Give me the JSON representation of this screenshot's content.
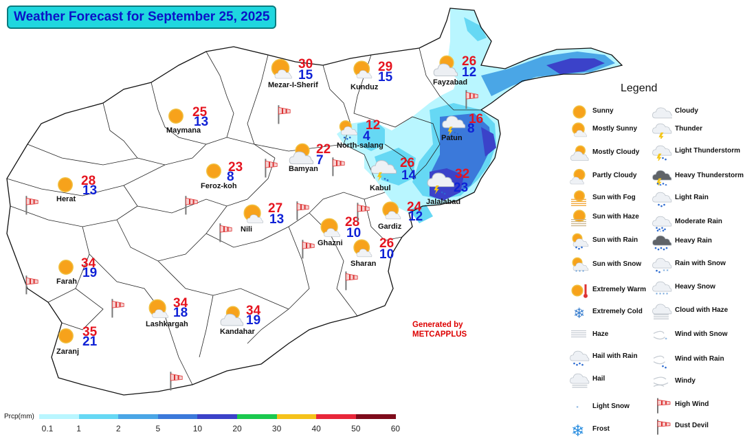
{
  "title": "Weather Forecast for September 25, 2025",
  "credit": {
    "line1": "Generated by",
    "line2": "METCAPPLUS"
  },
  "legend": {
    "title": "Legend",
    "left_column": [
      {
        "label": "Sunny",
        "icon": "sunny-icon"
      },
      {
        "label": "Mostly Sunny",
        "icon": "mostly-sunny-icon"
      },
      {
        "label": "Mostly Cloudy",
        "icon": "mostly-cloudy-icon"
      },
      {
        "label": "Partly Cloudy",
        "icon": "partly-cloudy-icon"
      },
      {
        "label": "Sun with Fog",
        "icon": "sun-fog-icon"
      },
      {
        "label": "Sun with Haze",
        "icon": "sun-haze-icon"
      },
      {
        "label": "Sun with Rain",
        "icon": "sun-rain-icon"
      },
      {
        "label": "Sun with Snow",
        "icon": "sun-snow-icon"
      },
      {
        "label": "Extremely Warm",
        "icon": "extremely-warm-icon"
      },
      {
        "label": "Extremely Cold",
        "icon": "extremely-cold-icon"
      },
      {
        "label": "Haze",
        "icon": "haze-icon"
      },
      {
        "label": "Hail with Rain",
        "icon": "hail-rain-icon"
      },
      {
        "label": "Hail",
        "icon": "hail-icon"
      },
      {
        "label": "Light Snow",
        "icon": "light-snow-icon"
      },
      {
        "label": "Frost",
        "icon": "frost-icon"
      }
    ],
    "right_column": [
      {
        "label": "Cloudy",
        "icon": "cloudy-icon"
      },
      {
        "label": "Thunder",
        "icon": "thunder-icon"
      },
      {
        "label": "Light Thunderstorm",
        "icon": "light-thunderstorm-icon"
      },
      {
        "label": "Heavy Thunderstorm",
        "icon": "heavy-thunderstorm-icon"
      },
      {
        "label": "Light Rain",
        "icon": "light-rain-icon"
      },
      {
        "label": "Moderate Rain",
        "icon": "moderate-rain-icon"
      },
      {
        "label": "Heavy Rain",
        "icon": "heavy-rain-icon"
      },
      {
        "label": "Rain with Snow",
        "icon": "rain-snow-icon"
      },
      {
        "label": "Heavy Snow",
        "icon": "heavy-snow-icon"
      },
      {
        "label": "Cloud with Haze",
        "icon": "cloud-haze-icon"
      },
      {
        "label": "Wind with Snow",
        "icon": "wind-snow-icon"
      },
      {
        "label": "Wind with Rain",
        "icon": "wind-rain-icon"
      },
      {
        "label": "Windy",
        "icon": "windy-icon"
      },
      {
        "label": "High Wind",
        "icon": "high-wind-icon"
      },
      {
        "label": "Dust Devil",
        "icon": "dust-devil-icon"
      }
    ]
  },
  "cities": [
    {
      "name": "Mezar-I-Sherif",
      "max": "30",
      "min": "15",
      "icon": "mostly-sunny-icon"
    },
    {
      "name": "Kunduz",
      "max": "29",
      "min": "15",
      "icon": "mostly-sunny-icon"
    },
    {
      "name": "Fayzabad",
      "max": "26",
      "min": "12",
      "icon": "mostly-cloudy-icon"
    },
    {
      "name": "Maymana",
      "max": "25",
      "min": "13",
      "icon": "sunny-icon"
    },
    {
      "name": "North-salang",
      "max": "12",
      "min": "4",
      "icon": "sun-rain-icon"
    },
    {
      "name": "Patun",
      "max": "16",
      "min": "8",
      "icon": "light-thunderstorm-icon"
    },
    {
      "name": "Bamyan",
      "max": "22",
      "min": "7",
      "icon": "mostly-cloudy-icon"
    },
    {
      "name": "Feroz-koh",
      "max": "23",
      "min": "8",
      "icon": "sunny-icon"
    },
    {
      "name": "Kabul",
      "max": "26",
      "min": "14",
      "icon": "light-thunderstorm-icon"
    },
    {
      "name": "Jalalabad",
      "max": "32",
      "min": "23",
      "icon": "light-thunderstorm-icon"
    },
    {
      "name": "Herat",
      "max": "28",
      "min": "13",
      "icon": "sunny-icon"
    },
    {
      "name": "Nili",
      "max": "27",
      "min": "13",
      "icon": "mostly-sunny-icon"
    },
    {
      "name": "Gardiz",
      "max": "24",
      "min": "12",
      "icon": "mostly-sunny-icon"
    },
    {
      "name": "Ghazni",
      "max": "28",
      "min": "10",
      "icon": "mostly-sunny-icon"
    },
    {
      "name": "Sharan",
      "max": "26",
      "min": "10",
      "icon": "mostly-sunny-icon"
    },
    {
      "name": "Farah",
      "max": "34",
      "min": "19",
      "icon": "sunny-icon"
    },
    {
      "name": "Lashkargah",
      "max": "34",
      "min": "18",
      "icon": "mostly-sunny-icon"
    },
    {
      "name": "Kandahar",
      "max": "34",
      "min": "19",
      "icon": "mostly-cloudy-icon"
    },
    {
      "name": "Zaranj",
      "max": "35",
      "min": "21",
      "icon": "sunny-icon"
    }
  ],
  "colorbar": {
    "label": "Prcp(mm)",
    "ticks": [
      "0.1",
      "1",
      "2",
      "5",
      "10",
      "20",
      "30",
      "40",
      "50",
      "60"
    ],
    "colors": [
      "#b9f6ff",
      "#66d8f4",
      "#4aa6e6",
      "#3b79da",
      "#3b42c9",
      "#1ac94e",
      "#f5c21a",
      "#e8263a",
      "#7e0b1b"
    ]
  }
}
